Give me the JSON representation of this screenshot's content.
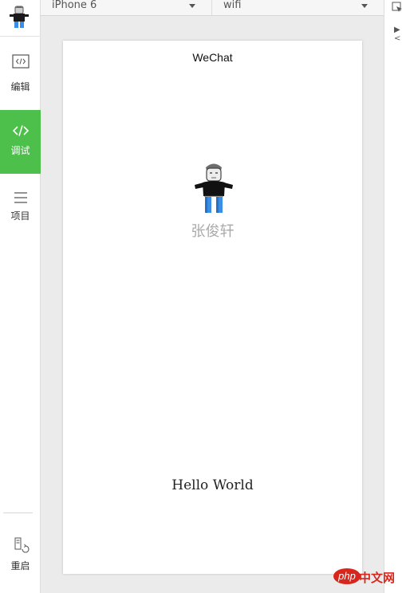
{
  "sidebar": {
    "items": [
      {
        "label": "编辑",
        "icon": "code-icon",
        "active": false
      },
      {
        "label": "调试",
        "icon": "code-icon",
        "active": true
      },
      {
        "label": "项目",
        "icon": "menu-icon",
        "active": false
      }
    ],
    "restart": {
      "label": "重启",
      "icon": "restart-icon"
    }
  },
  "toolbar": {
    "device": "iPhone 6",
    "network": "wifi"
  },
  "devtools": {
    "tree_marker": "▶ <"
  },
  "phone": {
    "nav_title": "WeChat",
    "user_name": "张俊轩",
    "hello_text": "Hello World"
  },
  "watermark": {
    "logo": "php",
    "text": "中文网"
  },
  "colors": {
    "active_green": "#4cc04a",
    "watermark_red": "#d9261c",
    "username_gray": "#aaaaaa"
  }
}
